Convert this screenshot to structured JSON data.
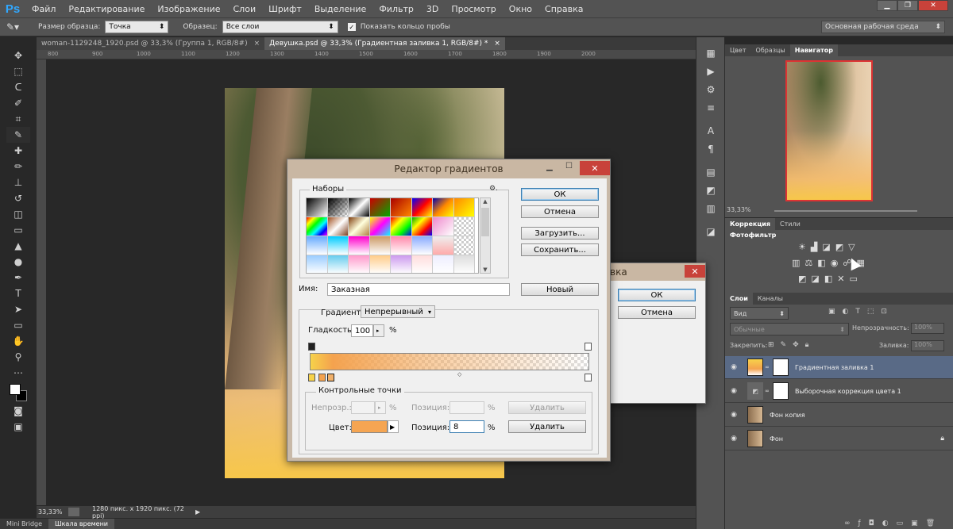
{
  "app": {
    "logo": "Ps"
  },
  "menu": [
    "Файл",
    "Редактирование",
    "Изображение",
    "Слои",
    "Шрифт",
    "Выделение",
    "Фильтр",
    "3D",
    "Просмотр",
    "Окно",
    "Справка"
  ],
  "window_controls": [
    "▁",
    "❐",
    "✕"
  ],
  "options": {
    "sample_size_label": "Размер образца:",
    "sample_size_value": "Точка",
    "sample_label": "Образец:",
    "sample_value": "Все слои",
    "show_ring_label": "Показать кольцо пробы",
    "workspace_value": "Основная рабочая среда"
  },
  "doc_tabs": [
    {
      "label": "woman-1129248_1920.psd @ 33,3% (Группа 1, RGB/8#)",
      "close": "×"
    },
    {
      "label": "Девушка.psd @ 33,3% (Градиентная заливка 1, RGB/8#) *",
      "close": "×"
    }
  ],
  "ruler_ticks": [
    "800",
    "900",
    "1000",
    "1100",
    "1200",
    "1300",
    "1400",
    "1500",
    "1600",
    "1700",
    "1800",
    "1900",
    "2000"
  ],
  "status": {
    "zoom": "33,33%",
    "info": "1280 пикс. x 1920 пикс. (72 ppi)",
    "arrow": "▶"
  },
  "bottom_tabs": [
    "Mini Bridge",
    "Шкала времени"
  ],
  "navigator": {
    "tabs": [
      "Цвет",
      "Образцы",
      "Навигатор"
    ],
    "zoom": "33,33%"
  },
  "adjustments": {
    "tabs": [
      "Коррекция",
      "Стили"
    ],
    "heading": "Фотофильтр"
  },
  "layers": {
    "tabs": [
      "Слои",
      "Каналы"
    ],
    "filter_value": "Вид",
    "blend_mode": "Обычные",
    "opacity_label": "Непрозрачность:",
    "opacity_value": "100%",
    "lock_label": "Закрепить:",
    "fill_label": "Заливка:",
    "fill_value": "100%",
    "items": [
      {
        "name": "Градиентная заливка 1"
      },
      {
        "name": "Выборочная коррекция цвета 1"
      },
      {
        "name": "Фон копия"
      },
      {
        "name": "Фон"
      }
    ]
  },
  "gradient_editor": {
    "title": "Редактор градиентов",
    "presets_label": "Наборы",
    "preset_menu": "⚙.",
    "ok": "ОК",
    "cancel": "Отмена",
    "load": "Загрузить...",
    "save": "Сохранить...",
    "name_label": "Имя:",
    "name_value": "Заказная",
    "new_button": "Новый",
    "gradient_type_label": "Градиент:",
    "gradient_type_value": "Непрерывный",
    "smoothness_label": "Гладкость:",
    "smoothness_value": "100",
    "smoothness_unit": "%",
    "stops_legend": "Контрольные точки",
    "opacity_label": "Непрозр.:",
    "opacity_unit": "%",
    "opacity_position_label": "Позиция:",
    "opacity_position_unit": "%",
    "delete_label": "Удалить",
    "color_label": "Цвет:",
    "color_value": "#f5a552",
    "position_label": "Позиция:",
    "position_value": "8",
    "position_unit": "%",
    "delete2_label": "Удалить"
  },
  "second_dialog": {
    "title_fragment": "вка",
    "ok": "ОК",
    "cancel": "Отмена"
  },
  "colors": {
    "accent_blue": "#31a8ff",
    "close_red": "#c8423a",
    "layer_selected": "#596a86",
    "gradient_start": "#f7d24a",
    "gradient_mid": "#f4a24e"
  }
}
